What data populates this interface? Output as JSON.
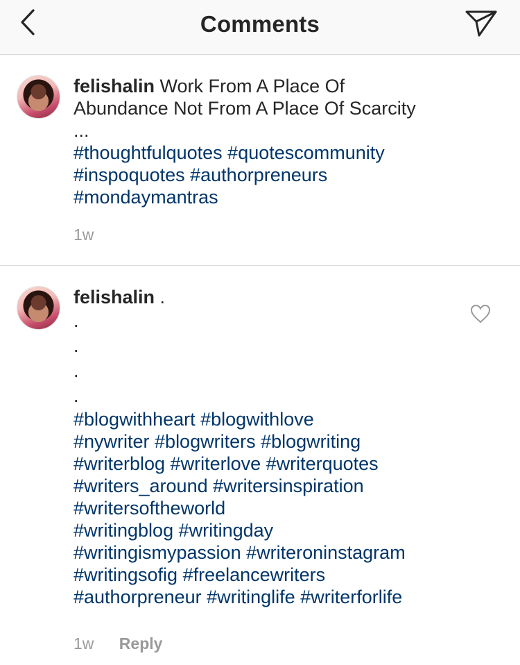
{
  "header": {
    "title": "Comments",
    "back_icon": "chevron-left-icon",
    "send_icon": "paper-plane-icon"
  },
  "caption": {
    "username": "felishalin",
    "text_line1": "Work From A Place Of",
    "text_line2": "Abundance Not From A Place Of Scarcity",
    "ellipsis": "...",
    "hashtag_lines": [
      "#thoughtfulquotes #quotescommunity",
      "#inspoquotes #authorpreneurs",
      "#mondaymantras"
    ],
    "time": "1w"
  },
  "comment": {
    "username": "felishalin",
    "first_text": ".",
    "dots": [
      ".",
      ".",
      ".",
      "."
    ],
    "hashtag_lines": [
      "#blogwithheart #blogwithlove",
      "#nywriter #blogwriters #blogwriting",
      "#writerblog #writerlove #writerquotes",
      "#writers_around #writersinspiration",
      "#writersoftheworld",
      "#writingblog #writingday",
      "#writingismypassion #writeroninstagram",
      "#writingsofig #freelancewriters",
      "#authorpreneur #writinglife #writerforlife"
    ],
    "time": "1w",
    "reply_label": "Reply",
    "like_icon": "heart-outline-icon"
  },
  "colors": {
    "hashtag": "#003569",
    "meta": "#999999",
    "text": "#262626",
    "header_bg": "#f9f9f9"
  }
}
